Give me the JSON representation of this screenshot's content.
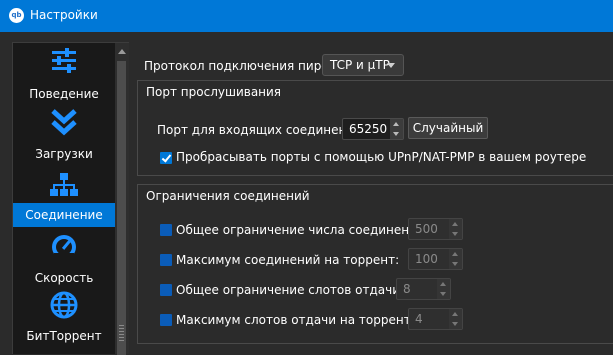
{
  "window": {
    "app_icon_text": "qb",
    "title": "Настройки"
  },
  "sidebar": {
    "items": [
      {
        "label": "Поведение",
        "icon": "sliders-icon",
        "selected": false
      },
      {
        "label": "Загрузки",
        "icon": "double-chevron-down-icon",
        "selected": false
      },
      {
        "label": "Соединение",
        "icon": "network-icon",
        "selected": true
      },
      {
        "label": "Скорость",
        "icon": "speedometer-icon",
        "selected": false
      },
      {
        "label": "БитТоррент",
        "icon": "globe-icon",
        "selected": false
      }
    ]
  },
  "connection": {
    "protocol_label": "Протокол подключения пиров:",
    "protocol_value": "TCP и µTP",
    "listening": {
      "title": "Порт прослушивания",
      "port_label": "Порт для входящих соединений:",
      "port_value": "65250",
      "random_button": "Случайный",
      "upnp_label": "Пробрасывать порты с помощью UPnP/NAT-PMP в вашем роутере",
      "upnp_checked": true
    },
    "limits": {
      "title": "Ограничения соединений",
      "rows": [
        {
          "label": "Общее ограничение числа соединений:",
          "value": "500",
          "checked": false
        },
        {
          "label": "Максимум соединений на торрент:",
          "value": "100",
          "checked": false
        },
        {
          "label": "Общее ограничение слотов отдачи:",
          "value": "8",
          "checked": false
        },
        {
          "label": "Максимум слотов отдачи на торрент:",
          "value": "4",
          "checked": false
        }
      ]
    }
  },
  "colors": {
    "accent": "#0078d7",
    "background": "#2b2b2b",
    "sidebar_bg": "#191919"
  }
}
